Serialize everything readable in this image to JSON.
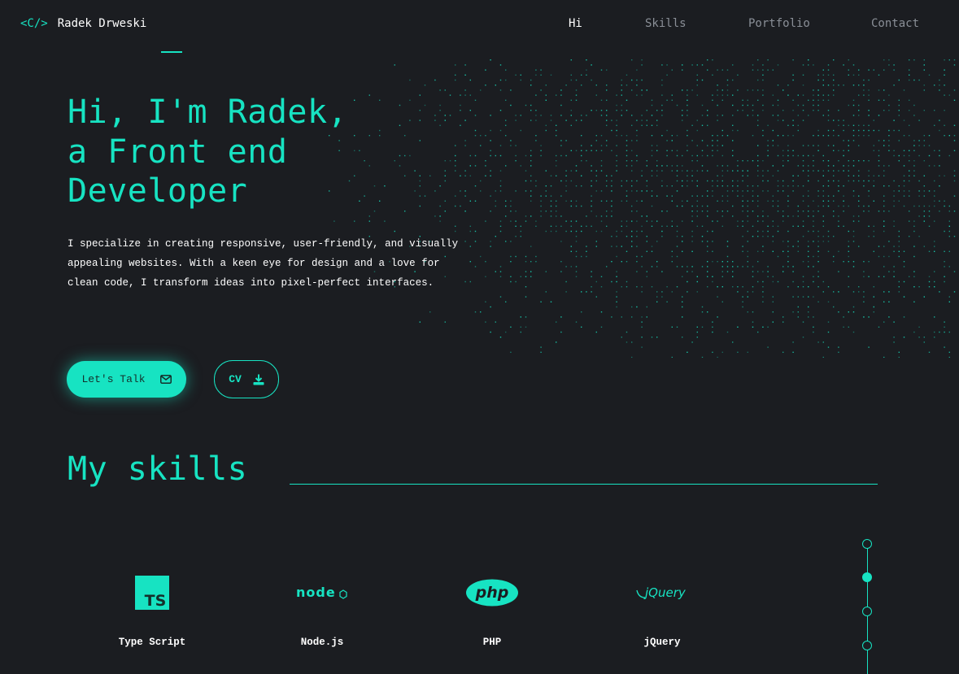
{
  "header": {
    "logo_mark": "<C/>",
    "logo_name": "Radek Drweski",
    "nav": [
      {
        "label": "Hi",
        "active": true
      },
      {
        "label": "Skills",
        "active": false
      },
      {
        "label": "Portfolio",
        "active": false
      },
      {
        "label": "Contact",
        "active": false
      }
    ]
  },
  "hero": {
    "title_lines": [
      "Hi, I'm Radek,",
      "a Front end",
      "Developer"
    ],
    "description": "I specialize in creating responsive, user-friendly, and visually appealing websites. With a keen eye for design and a love for clean code, I transform ideas into pixel-perfect interfaces.",
    "buttons": {
      "talk_label": "Let's Talk",
      "talk_icon": "envelope-icon",
      "cv_label": "CV",
      "cv_icon": "download-icon"
    }
  },
  "skills": {
    "title": "My skills",
    "items": [
      {
        "label": "Type Script",
        "icon": "typescript-icon",
        "icon_text": "TS"
      },
      {
        "label": "Node.js",
        "icon": "nodejs-icon",
        "icon_text": "node"
      },
      {
        "label": "PHP",
        "icon": "php-icon",
        "icon_text": "php"
      },
      {
        "label": "jQuery",
        "icon": "jquery-icon",
        "icon_text": "jQuery"
      }
    ]
  },
  "timeline": {
    "steps": 4,
    "active_step": 2
  },
  "colors": {
    "accent": "#17e3c2",
    "background": "#1b1d21",
    "text": "#ffffff",
    "muted": "#8a8f97"
  }
}
